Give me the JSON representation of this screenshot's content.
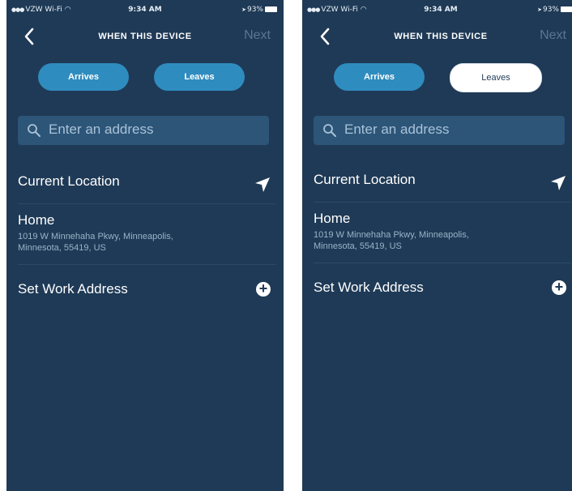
{
  "status": {
    "carrier": "VZW Wi-Fi",
    "time": "9:34 AM",
    "battery": "93%"
  },
  "nav": {
    "title": "WHEN THIS DEVICE",
    "next": "Next"
  },
  "toggle": {
    "arrives": "Arrives",
    "leaves": "Leaves"
  },
  "left_screen": {
    "selected": "Arrives"
  },
  "right_screen": {
    "selected": "Leaves"
  },
  "search": {
    "placeholder": "Enter an address"
  },
  "locations": {
    "current": "Current Location",
    "home_title": "Home",
    "home_line1": "1019 W Minnehaha Pkwy, Minneapolis,",
    "home_line2": "Minnesota, 55419, US",
    "work": "Set Work Address"
  },
  "colors": {
    "background": "#1f3a56",
    "accent": "#2f8cbf",
    "search_bg": "#2c5578"
  }
}
